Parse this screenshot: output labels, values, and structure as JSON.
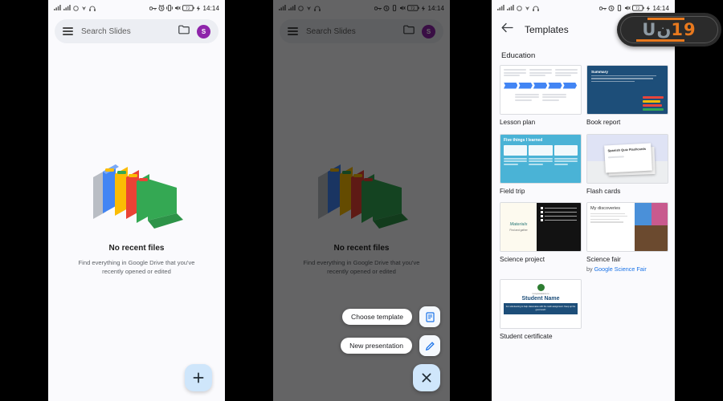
{
  "statusbar": {
    "time": "14:14",
    "battery": "72"
  },
  "panel1": {
    "search": {
      "placeholder": "Search Slides",
      "menu_icon": "hamburger-icon",
      "folder_icon": "folder-icon",
      "avatar_initial": "S"
    },
    "empty": {
      "illustration": "folders-illustration",
      "title": "No recent files",
      "subtitle": "Find everything in Google Drive that you've recently opened or edited"
    },
    "fab": {
      "icon": "plus-icon",
      "label": "+"
    }
  },
  "panel2": {
    "search": {
      "placeholder": "Search Slides",
      "avatar_initial": "S"
    },
    "empty": {
      "title": "No recent files",
      "subtitle": "Find everything in Google Drive that you've recently opened or edited"
    },
    "menu": [
      {
        "label": "Choose template",
        "icon": "document-icon"
      },
      {
        "label": "New presentation",
        "icon": "pencil-icon"
      }
    ],
    "close": {
      "icon": "close-icon",
      "label": "×"
    }
  },
  "panel3": {
    "header": {
      "back_icon": "back-arrow-icon",
      "title": "Templates"
    },
    "section": "Education",
    "templates": [
      {
        "name": "Lesson plan",
        "thumb": "lesson-plan-thumb"
      },
      {
        "name": "Book report",
        "thumb": "book-report-thumb",
        "slide_title": "Summary"
      },
      {
        "name": "Field trip",
        "thumb": "field-trip-thumb",
        "slide_title": "Five things I learned"
      },
      {
        "name": "Flash cards",
        "thumb": "flash-cards-thumb",
        "slide_title": "Spanish Quiz Flashcards"
      },
      {
        "name": "Science project",
        "thumb": "science-project-thumb",
        "slide_title": "Materials"
      },
      {
        "name": "Science fair",
        "thumb": "science-fair-thumb",
        "slide_title": "My discoveries",
        "by_prefix": "by ",
        "by_link": "Google Science Fair"
      },
      {
        "name": "Student certificate",
        "thumb": "student-certificate-thumb",
        "cert_top": "Congratulations to",
        "cert_name": "Student Name",
        "cert_body": "For volunteering to help classmates with the math assignment. Keep up the good work!"
      }
    ]
  },
  "watermark": {
    "text_left": "Uن",
    "text_right": "19"
  },
  "colors": {
    "accent": "#1a73e8",
    "fab": "#cfe6fb",
    "avatar": "#8e24aa"
  }
}
